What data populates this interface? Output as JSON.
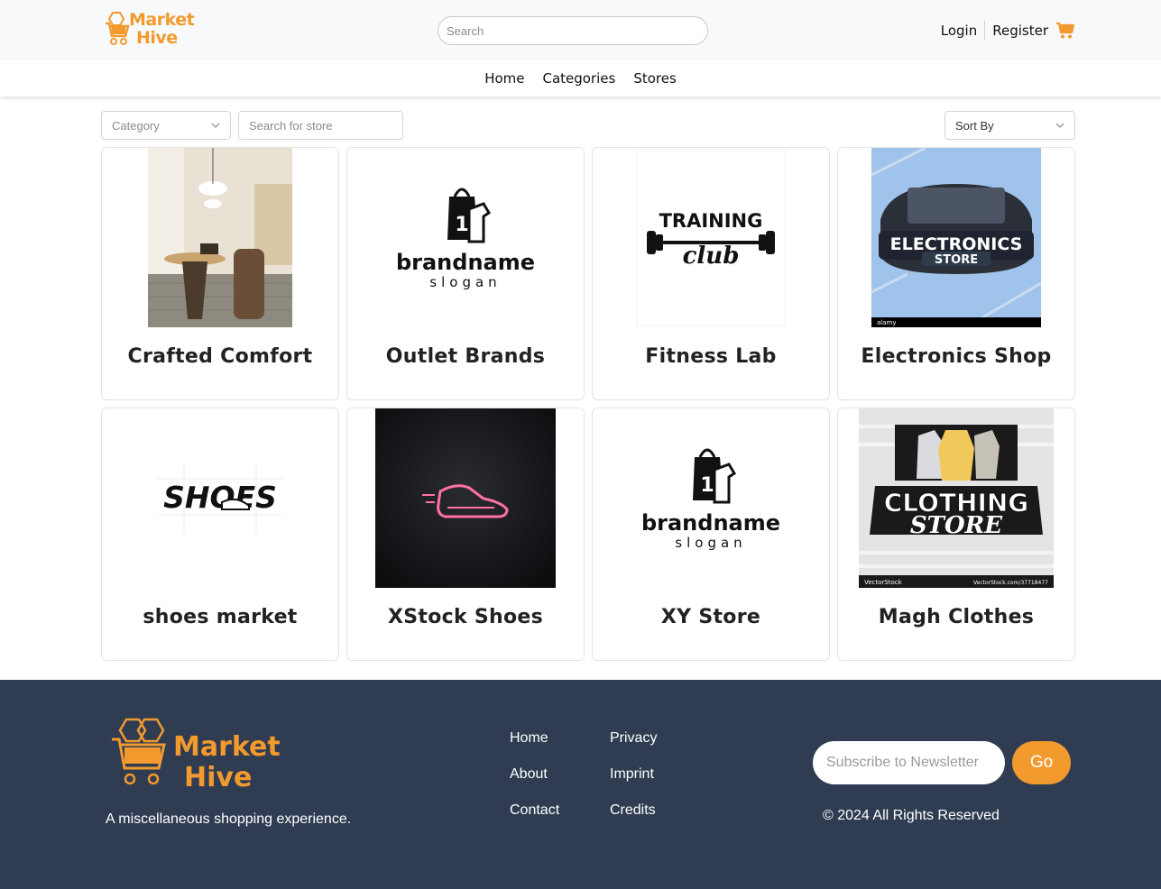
{
  "brand": {
    "name_line1": "Market",
    "name_line2": "Hive",
    "accent_color": "#f29a2e"
  },
  "header": {
    "search_placeholder": "Search",
    "login": "Login",
    "register": "Register",
    "cart_icon": "cart-icon"
  },
  "nav": {
    "items": [
      "Home",
      "Categories",
      "Stores"
    ]
  },
  "filters": {
    "category_placeholder": "Category",
    "store_search_placeholder": "Search for store",
    "sort_label": "Sort By"
  },
  "stores": [
    {
      "name": "Crafted Comfort",
      "image": "interior-room-photo"
    },
    {
      "name": "Outlet Brands",
      "image": "brandname-logo",
      "logo_text": "brandname",
      "logo_slogan": "slogan"
    },
    {
      "name": "Fitness Lab",
      "image": "training-club-logo",
      "logo_text": "TRAINING",
      "logo_slogan": "club"
    },
    {
      "name": "Electronics Shop",
      "image": "electronics-store-logo",
      "logo_text": "ELECTRONICS",
      "logo_slogan": "STORE",
      "credit": "alamy"
    },
    {
      "name": "shoes market",
      "image": "shoes-logo",
      "logo_text": "SHOES"
    },
    {
      "name": "XStock Shoes",
      "image": "neon-shoe-logo"
    },
    {
      "name": "XY Store",
      "image": "brandname-logo",
      "logo_text": "brandname",
      "logo_slogan": "slogan"
    },
    {
      "name": "Magh Clothes",
      "image": "clothing-store-logo",
      "logo_text": "CLOTHING",
      "logo_slogan": "STORE",
      "credit": "VectorStock",
      "credit_url": "VectorStock.com/37718477"
    }
  ],
  "footer": {
    "tagline": "A miscellaneous shopping experience.",
    "col1": [
      "Home",
      "About",
      "Contact"
    ],
    "col2": [
      "Privacy",
      "Imprint",
      "Credits"
    ],
    "newsletter_placeholder": "Subscribe to Newsletter",
    "go_label": "Go",
    "copyright": "© 2024 All Rights Reserved"
  }
}
